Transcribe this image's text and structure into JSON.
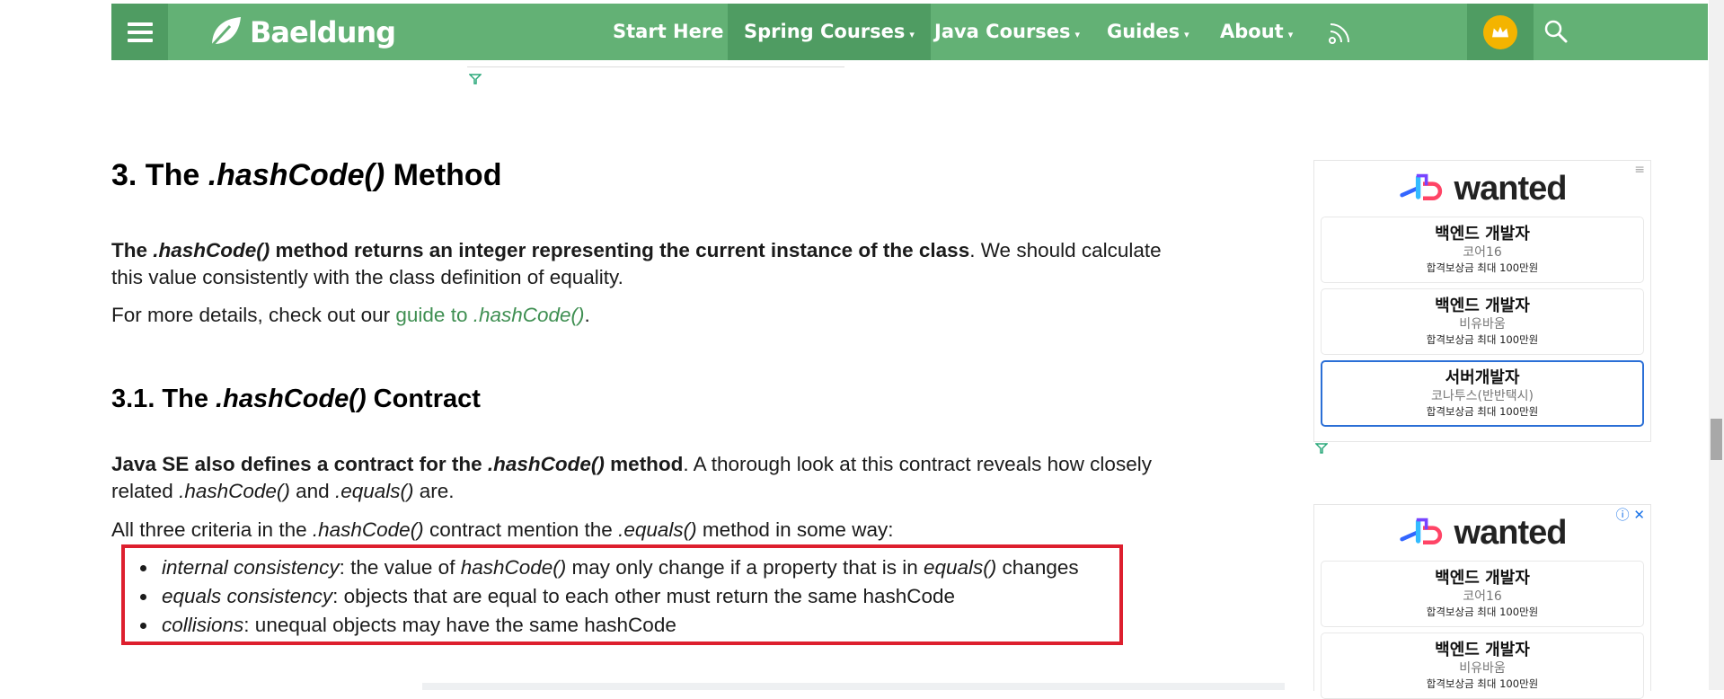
{
  "nav": {
    "brand": "Baeldung",
    "items": [
      {
        "label": "Start Here",
        "has_caret": false
      },
      {
        "label": "Spring Courses",
        "has_caret": true,
        "active": true
      },
      {
        "label": "Java Courses",
        "has_caret": true
      },
      {
        "label": "Guides",
        "has_caret": true
      },
      {
        "label": "About",
        "has_caret": true
      }
    ],
    "caret": "▾",
    "icons": [
      "menu-icon",
      "leaf-logo-icon",
      "rss-icon",
      "crown-icon",
      "search-icon"
    ],
    "colors": {
      "bar": "#63b175",
      "active": "#4f9c62"
    }
  },
  "article": {
    "h2": {
      "prefix": "3. The ",
      "code": ".hashCode()",
      "suffix": " Method"
    },
    "p1": {
      "bold_a": "The ",
      "bold_code": ".hashCode()",
      "bold_b": " method returns an integer representing the current instance of the class",
      "rest": ". We should calculate this value consistently with the class definition of equality."
    },
    "p2": {
      "text": "For more details, check out our ",
      "link_a": "guide to ",
      "link_code": ".hashCode()",
      "end": "."
    },
    "h3": {
      "prefix": "3.1. The ",
      "code": ".hashCode()",
      "suffix": " Contract"
    },
    "p3": {
      "bold_a": "Java SE also defines a contract for the ",
      "bold_code": ".hashCode()",
      "bold_b": " method",
      "rest_a": ". A thorough look at this contract reveals how closely related ",
      "code1": ".hashCode()",
      "rest_b": " and ",
      "code2": ".equals()",
      "rest_c": " are."
    },
    "p4": {
      "a": "All three criteria in the ",
      "code1": ".hashCode()",
      "b": " contract mention the ",
      "code2": ".equals()",
      "c": " method in some way:"
    },
    "criteria": [
      {
        "term": "internal consistency",
        "a": ": the value of ",
        "code1": "hashCode()",
        "b": " may only change if a property that is in ",
        "code2": "equals()",
        "c": " changes"
      },
      {
        "term": "equals consistency",
        "a": ": objects that are equal to each other must return the same hashCode"
      },
      {
        "term": "collisions",
        "a": ": unequal objects may have the same hashCode"
      }
    ],
    "highlight_color": "#dd1f2e"
  },
  "sidebar": {
    "ad1": {
      "brand": "wanted",
      "jobs": [
        {
          "title": "백엔드 개발자",
          "company": "코어16",
          "reward": "합격보상금 최대 100만원"
        },
        {
          "title": "백엔드 개발자",
          "company": "비유바움",
          "reward": "합격보상금 최대 100만원"
        },
        {
          "title": "서버개발자",
          "company": "코나투스(반반택시)",
          "reward": "합격보상금 최대 100만원",
          "selected": true
        }
      ]
    },
    "ad2": {
      "brand": "wanted",
      "info_glyph": "ⓘ",
      "close_glyph": "✕",
      "jobs": [
        {
          "title": "백엔드 개발자",
          "company": "코어16",
          "reward": "합격보상금 최대 100만원"
        },
        {
          "title": "백엔드 개발자",
          "company": "비유바움",
          "reward": "합격보상금 최대 100만원"
        }
      ]
    },
    "menu_glyph": "≡"
  }
}
